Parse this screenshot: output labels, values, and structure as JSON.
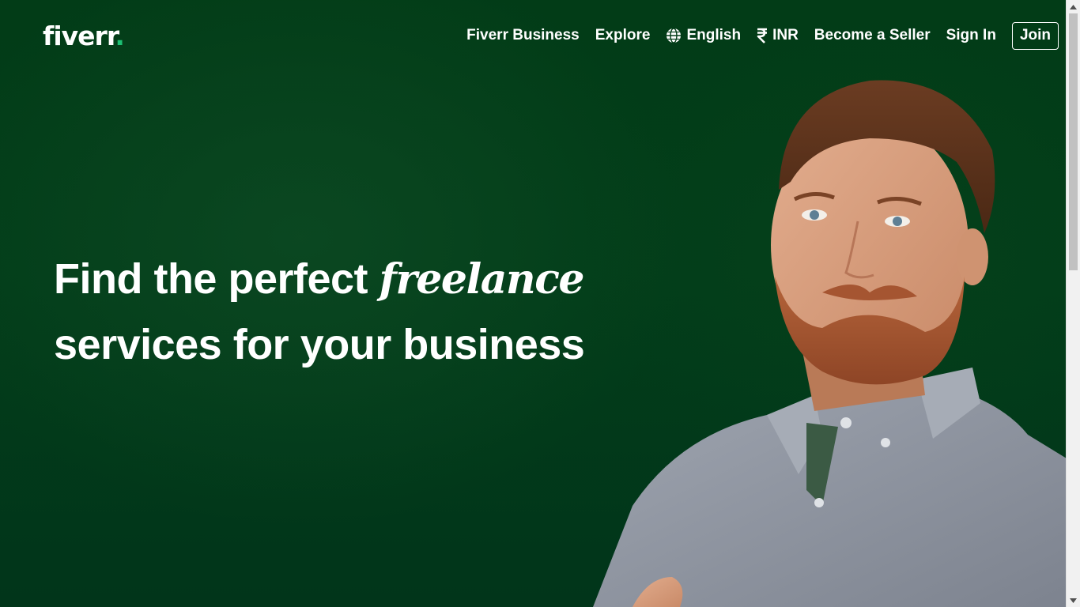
{
  "brand": {
    "logo_text": "fiverr",
    "logo_dot": ".",
    "accent_color": "#1dbf73",
    "background_color": "#013914"
  },
  "nav": {
    "fiverr_business": "Fiverr Business",
    "explore": "Explore",
    "language": {
      "label": "English",
      "icon": "globe-icon"
    },
    "currency": {
      "label": "INR",
      "icon": "rupee-icon"
    },
    "become_seller": "Become a Seller",
    "sign_in": "Sign In",
    "join": "Join"
  },
  "hero": {
    "headline_part1": "Find the perfect ",
    "headline_emphasis": "freelance",
    "headline_part2": "services for your business"
  },
  "scrollbar": {
    "up_icon": "scroll-up-arrow-icon",
    "down_icon": "scroll-down-arrow-icon"
  }
}
